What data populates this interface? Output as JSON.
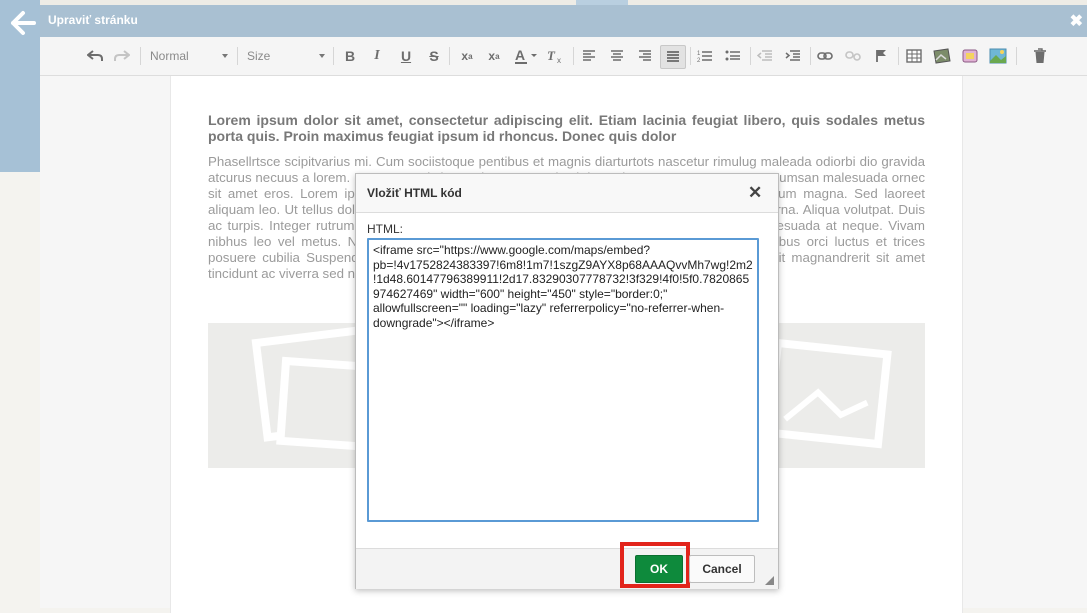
{
  "window": {
    "title": "Upraviť stránku"
  },
  "toolbar": {
    "format_combo": "Normal",
    "size_combo": "Size",
    "icons": [
      "undo-icon",
      "redo-icon",
      "bold-icon",
      "italic-icon",
      "underline-icon",
      "strikethrough-icon",
      "subscript-icon",
      "superscript-icon",
      "text-color-icon",
      "remove-format-icon",
      "align-left-icon",
      "align-center-icon",
      "align-right-icon",
      "align-justify-icon",
      "numbered-list-icon",
      "bulleted-list-icon",
      "outdent-icon",
      "indent-icon",
      "link-icon",
      "unlink-icon",
      "anchor-icon",
      "table-icon",
      "image-gallery-icon",
      "widget-icon",
      "image-icon",
      "delete-icon"
    ]
  },
  "document": {
    "lead": "Lorem ipsum dolor sit amet, consectetur adipiscing elit. Etiam lacinia feugiat libero, quis sodales metus porta quis. Proin maximus feugiat ipsum id rhoncus. Donec quis dolor",
    "paragraph": "Phasellrtsce scipitvarius mi. Cum sociistoque pentibus et magnis diarturtots nascetur rimulug maleada odiorbi dio gravida atcurus necuus a lorem. Maecenas tristique ori ac sem. Duis ultrices pharetra magna. Donec accumsan malesuada ornec sit amet eros. Lorem ipsum dolor sit amet, consectetuer adipiscing elit. Mauris fermentum tum magna. Sed laoreet aliquam leo. Ut tellus dolor, dapibus eget, elementum vel, cursus eleifend, elit. Aenean auctor wrna. Aliqua volutpat. Duis ac turpis. Integer rutrum ante eu lacus. Vestibulum libero nisl, porta vel, scelerisque eget malesuada at neque. Vivam nibhus leo vel metus. Nulla facilisi. Aenean nec eros. Vestibulum ante ipsum primis in faucibus orci luctus et trices posuere cubilia Suspendisse sollicitudin velit sed leo. Ut pharetra augue nec augue. Nam elit magnandrerit sit amet tincidunt ac viverra sed nulla."
  },
  "dialog": {
    "title": "Vložiť HTML kód",
    "field_label": "HTML:",
    "html_value": "<iframe src=\"https://www.google.com/maps/embed?pb=!4v1752824383397!6m8!1m7!1szgZ9AYX8p68AAAQvvMh7wg!2m2!1d48.60147796389911!2d17.83290307778732!3f329!4f0!5f0.7820865974627469\" width=\"600\" height=\"450\" style=\"border:0;\" allowfullscreen=\"\" loading=\"lazy\" referrerpolicy=\"no-referrer-when-downgrade\"></iframe>",
    "ok_label": "OK",
    "cancel_label": "Cancel"
  },
  "colors": {
    "titlebar": "#a9c0d2",
    "ok_button": "#0e8a3c",
    "highlight": "#e2241b",
    "focus_border": "#5a9ad5"
  }
}
